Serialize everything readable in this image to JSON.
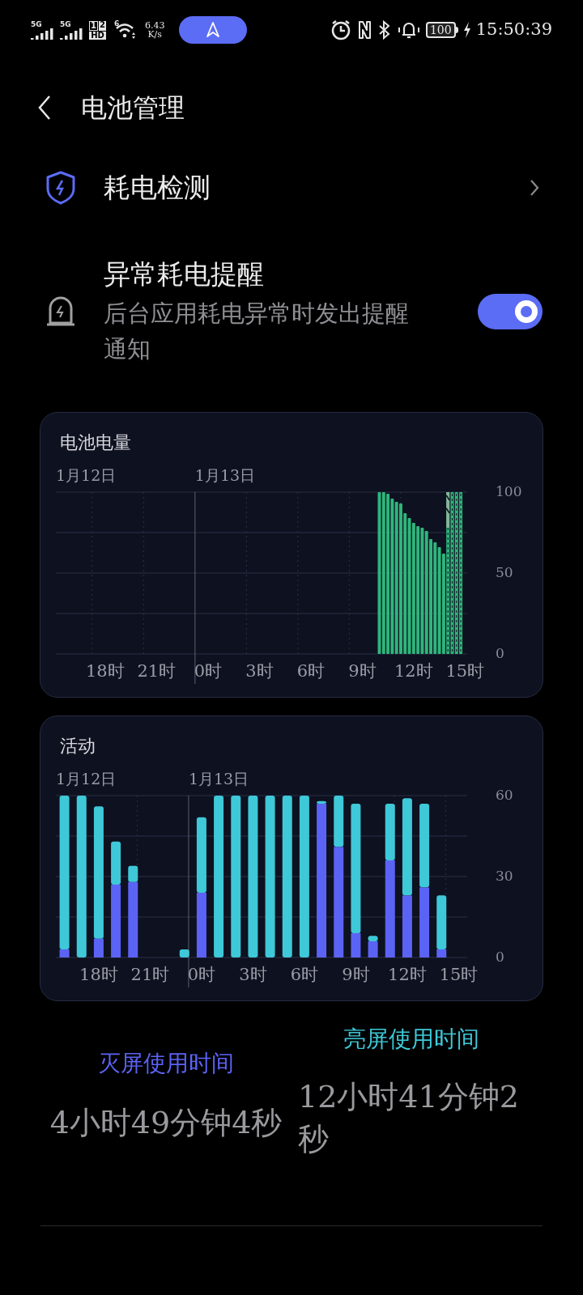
{
  "status_bar": {
    "signals": [
      "5G",
      "5G"
    ],
    "hd_badge": [
      "1",
      "2",
      "HD"
    ],
    "wifi_badge": "6",
    "speed_value": "6.43",
    "speed_unit": "K/s",
    "battery": "100",
    "time": "15:50:39"
  },
  "header": {
    "title": "电池管理"
  },
  "power_check": {
    "label": "耗电检测"
  },
  "abnormal_alert": {
    "title": "异常耗电提醒",
    "description": "后台应用耗电异常时发出提醒通知",
    "on": true
  },
  "battery_card": {
    "chart_data": {
      "type": "bar",
      "title": "电池电量",
      "grid": true,
      "categories": [
        null,
        null,
        null,
        null,
        null,
        null,
        null,
        null,
        null,
        null,
        null,
        "18时",
        null,
        null,
        null,
        null,
        null,
        null,
        null,
        null,
        null,
        null,
        null,
        "21时",
        null,
        null,
        null,
        null,
        null,
        null,
        null,
        null,
        null,
        null,
        null,
        "0时",
        null,
        null,
        null,
        null,
        null,
        null,
        null,
        null,
        null,
        null,
        null,
        "3时",
        null,
        null,
        null,
        null,
        null,
        null,
        null,
        null,
        null,
        null,
        null,
        "6时",
        null,
        null,
        null,
        null,
        null,
        null,
        null,
        null,
        null,
        null,
        null,
        "9时",
        null,
        null,
        null,
        null,
        null,
        null,
        null,
        null,
        null,
        null,
        null,
        "12时",
        null,
        null,
        null,
        null,
        null,
        null,
        null,
        null,
        null,
        null,
        null,
        "15时"
      ],
      "series": [
        {
          "color": "#2fb67c",
          "values": [
            null,
            null,
            null,
            null,
            null,
            null,
            null,
            null,
            null,
            null,
            null,
            null,
            null,
            null,
            null,
            null,
            null,
            null,
            null,
            null,
            null,
            null,
            null,
            null,
            null,
            null,
            null,
            null,
            null,
            null,
            null,
            null,
            null,
            null,
            null,
            null,
            null,
            null,
            null,
            null,
            null,
            null,
            null,
            null,
            null,
            null,
            null,
            null,
            null,
            null,
            null,
            null,
            null,
            null,
            null,
            null,
            null,
            null,
            null,
            null,
            null,
            null,
            null,
            null,
            null,
            null,
            null,
            null,
            null,
            null,
            null,
            null,
            null,
            null,
            null,
            100,
            100,
            99,
            96,
            94,
            93,
            87,
            84,
            81,
            79,
            78,
            76,
            71,
            69,
            66,
            62,
            100,
            100,
            100,
            100,
            null
          ]
        }
      ],
      "ylim": [
        0,
        100
      ],
      "yticks": [
        0,
        50,
        100
      ],
      "annotations": [
        "1月12日",
        "1月13日"
      ]
    }
  },
  "activity_card": {
    "chart_data": {
      "type": "bar",
      "title": "活动",
      "stacked": true,
      "grid": true,
      "categories": [
        null,
        null,
        "18时",
        null,
        null,
        "21时",
        null,
        null,
        "0时",
        null,
        null,
        "3时",
        null,
        null,
        "6时",
        null,
        null,
        "9时",
        null,
        null,
        "12时",
        null,
        null,
        "15时"
      ],
      "series": [
        {
          "name": "灭屏使用时间",
          "color": "#5b63f5",
          "values": [
            3,
            0,
            7,
            27,
            28,
            0,
            0,
            0,
            24,
            0,
            0,
            0,
            0,
            0,
            0,
            57,
            41,
            9,
            6,
            36,
            23,
            26,
            3,
            0
          ]
        },
        {
          "name": "亮屏使用时间",
          "color": "#3ec8d8",
          "values": [
            57,
            60,
            49,
            16,
            6,
            0,
            0,
            3,
            28,
            60,
            60,
            60,
            60,
            60,
            60,
            1,
            19,
            48,
            2,
            21,
            36,
            31,
            20,
            0
          ]
        }
      ],
      "ylim": [
        0,
        60
      ],
      "yticks": [
        0,
        30,
        60
      ],
      "annotations": [
        "1月12日",
        "1月13日"
      ]
    }
  },
  "usage_summary": [
    {
      "value": "4小时49分钟4秒"
    },
    {
      "value": "12小时41分钟2秒"
    }
  ]
}
